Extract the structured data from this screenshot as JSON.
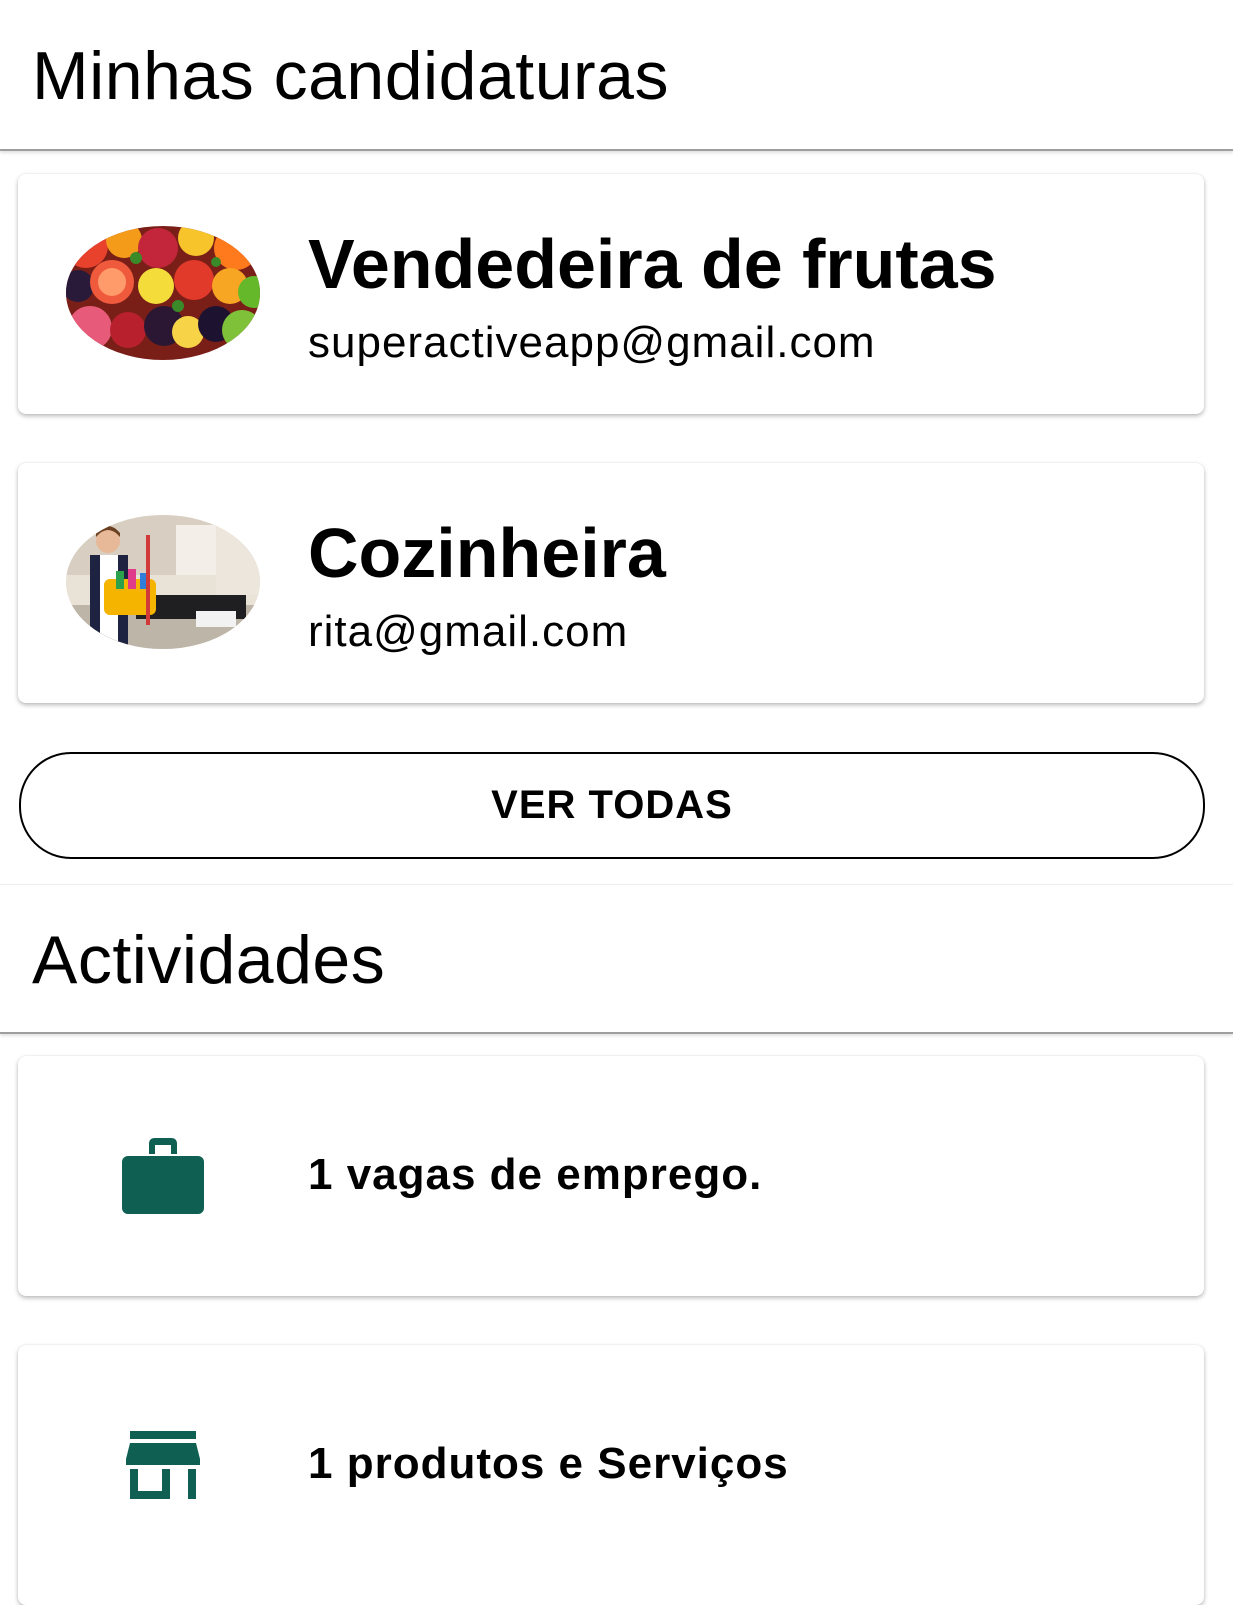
{
  "applications": {
    "title": "Minhas candidaturas",
    "items": [
      {
        "title": "Vendedeira de frutas",
        "email": "superactiveapp@gmail.com",
        "image": "fruits-photo"
      },
      {
        "title": "Cozinheira",
        "email": "rita@gmail.com",
        "image": "housekeeper-photo"
      }
    ],
    "view_all_label": "VER TODAS"
  },
  "activities": {
    "title": "Actividades",
    "items": [
      {
        "label": "1 vagas de emprego.",
        "icon": "briefcase-icon"
      },
      {
        "label": "1 produtos e Serviços",
        "icon": "store-icon"
      }
    ]
  },
  "colors": {
    "icon": "#0f5f52",
    "divider": "#9e9e9e"
  }
}
